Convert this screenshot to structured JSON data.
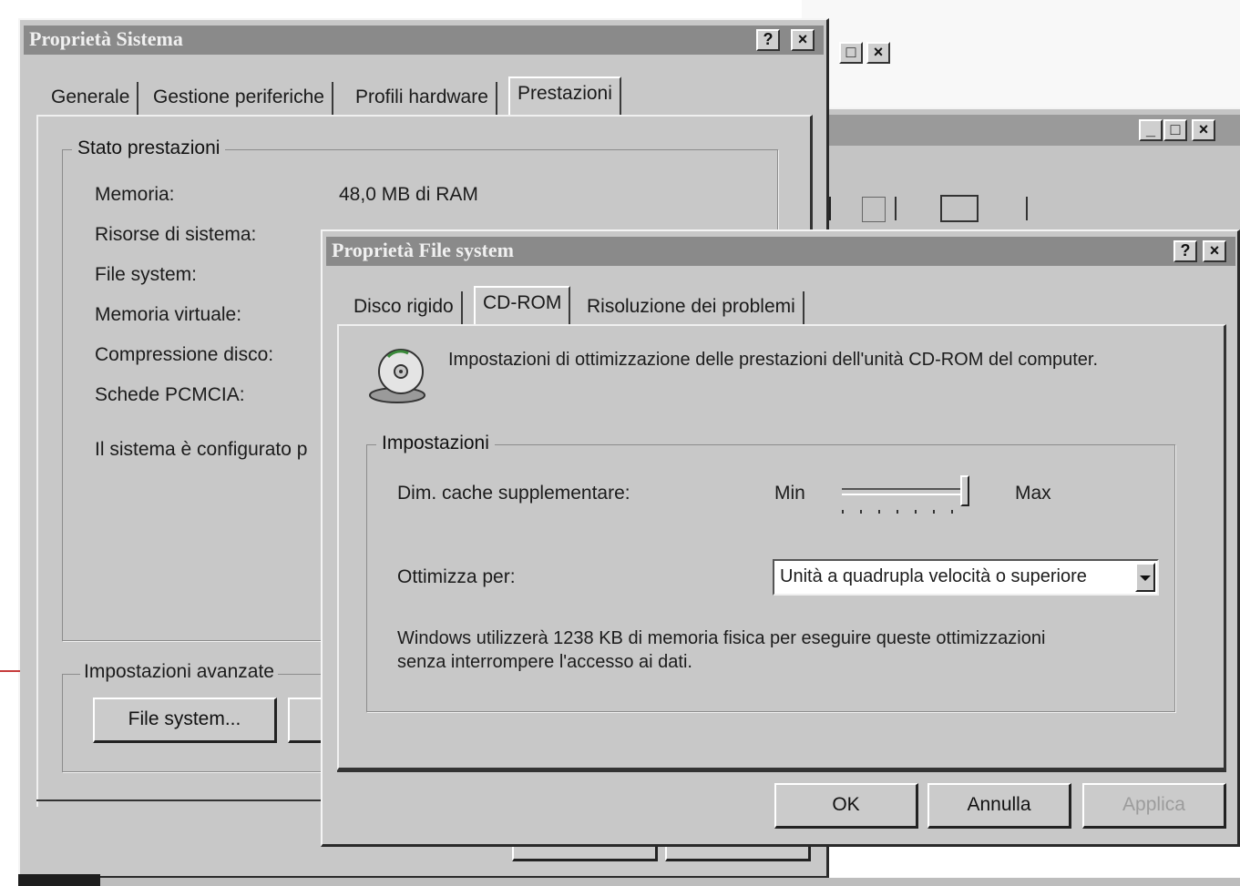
{
  "bg_windows": {
    "top_right_buttons": [
      "□",
      "×"
    ],
    "second_window_buttons": [
      "_",
      "□",
      "×"
    ],
    "toolbar_icons": [
      "properties-icon",
      "large-icons-icon",
      "small-icons-icon",
      "list-icon",
      "details-icon"
    ]
  },
  "system_props": {
    "title": "Proprietà Sistema",
    "help_btn": "?",
    "close_btn": "×",
    "tabs": [
      "Generale",
      "Gestione periferiche",
      "Profili hardware",
      "Prestazioni"
    ],
    "active_tab": "Prestazioni",
    "group_title": "Stato prestazioni",
    "rows": [
      {
        "label": "Memoria:",
        "value": "48,0 MB di RAM"
      },
      {
        "label": "Risorse di sistema:",
        "value": ""
      },
      {
        "label": "File system:",
        "value": ""
      },
      {
        "label": "Memoria virtuale:",
        "value": ""
      },
      {
        "label": "Compressione disco:",
        "value": ""
      },
      {
        "label": "Schede PCMCIA:",
        "value": ""
      }
    ],
    "status_text": "Il sistema è configurato p",
    "advanced_title": "Impostazioni avanzate",
    "file_system_button": "File system..."
  },
  "fs_props": {
    "title": "Proprietà File system",
    "help_btn": "?",
    "close_btn": "×",
    "tabs": [
      "Disco rigido",
      "CD-ROM",
      "Risoluzione dei problemi"
    ],
    "active_tab": "CD-ROM",
    "description": "Impostazioni di ottimizzazione delle prestazioni dell'unità CD-ROM del computer.",
    "settings_title": "Impostazioni",
    "cache_label": "Dim. cache supplementare:",
    "slider_min": "Min",
    "slider_max": "Max",
    "slider_value": 1.0,
    "optimize_label": "Ottimizza per:",
    "optimize_value": "Unità a quadrupla velocità o superiore",
    "info_text_1": "Windows utilizzerà 1238 KB di memoria fisica per eseguire queste ottimizzazioni",
    "info_text_2": "senza interrompere l'accesso ai dati.",
    "ok_button": "OK",
    "cancel_button": "Annulla",
    "apply_button": "Applica"
  }
}
